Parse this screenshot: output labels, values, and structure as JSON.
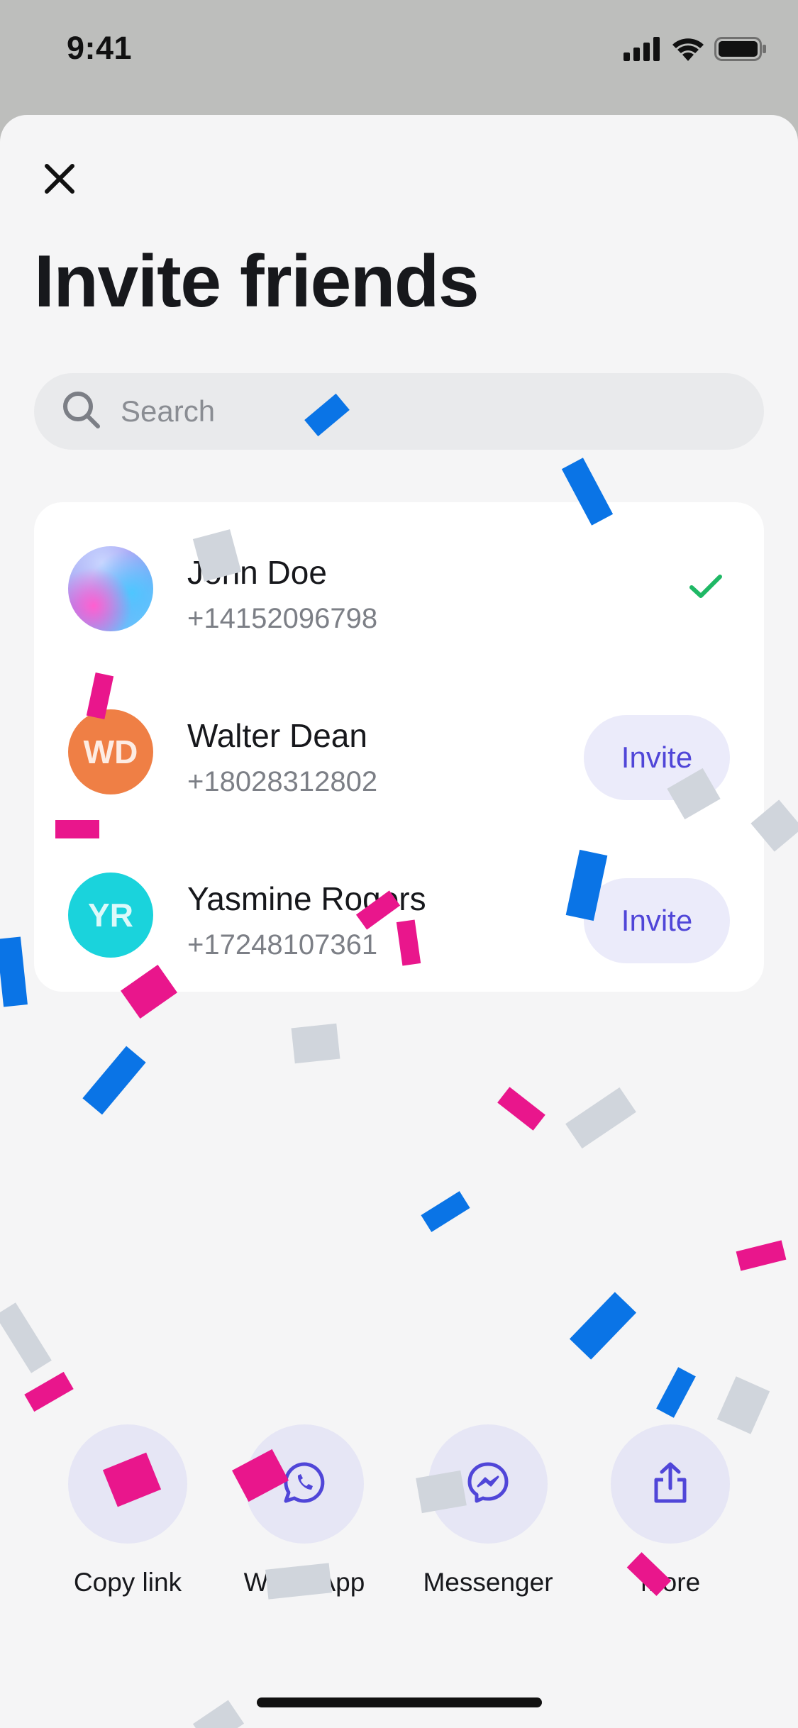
{
  "status_bar": {
    "time": "9:41",
    "icons": [
      "signal-icon",
      "wifi-icon",
      "battery-icon"
    ]
  },
  "header": {
    "close_icon": "close-icon",
    "title": "Invite friends"
  },
  "search": {
    "placeholder": "Search",
    "value": "",
    "icon": "search-icon"
  },
  "contacts": [
    {
      "name": "John Doe",
      "phone": "+14152096798",
      "avatar_initials": "",
      "avatar_color": "gradient",
      "status": "invited",
      "status_icon": "check-icon",
      "status_color": "#1fb865"
    },
    {
      "name": "Walter Dean",
      "phone": "+18028312802",
      "avatar_initials": "WD",
      "avatar_color": "#ef7f45",
      "status": "not-invited",
      "action_label": "Invite"
    },
    {
      "name": "Yasmine Rogers",
      "phone": "+17248107361",
      "avatar_initials": "YR",
      "avatar_color": "#1ad3dc",
      "status": "not-invited",
      "action_label": "Invite"
    }
  ],
  "share_options": [
    {
      "label": "Copy link",
      "icon": "link-icon"
    },
    {
      "label": "WhatsApp",
      "icon": "whatsapp-icon"
    },
    {
      "label": "Messenger",
      "icon": "messenger-icon"
    },
    {
      "label": "More",
      "icon": "share-icon"
    }
  ],
  "colors": {
    "accent": "#5046d8",
    "accent_bg": "#ebebfa",
    "sheet_bg": "#f5f5f6",
    "confetti_blue": "#0a74e6",
    "confetti_pink": "#e9168c",
    "confetti_gray": "#d0d5dc"
  }
}
